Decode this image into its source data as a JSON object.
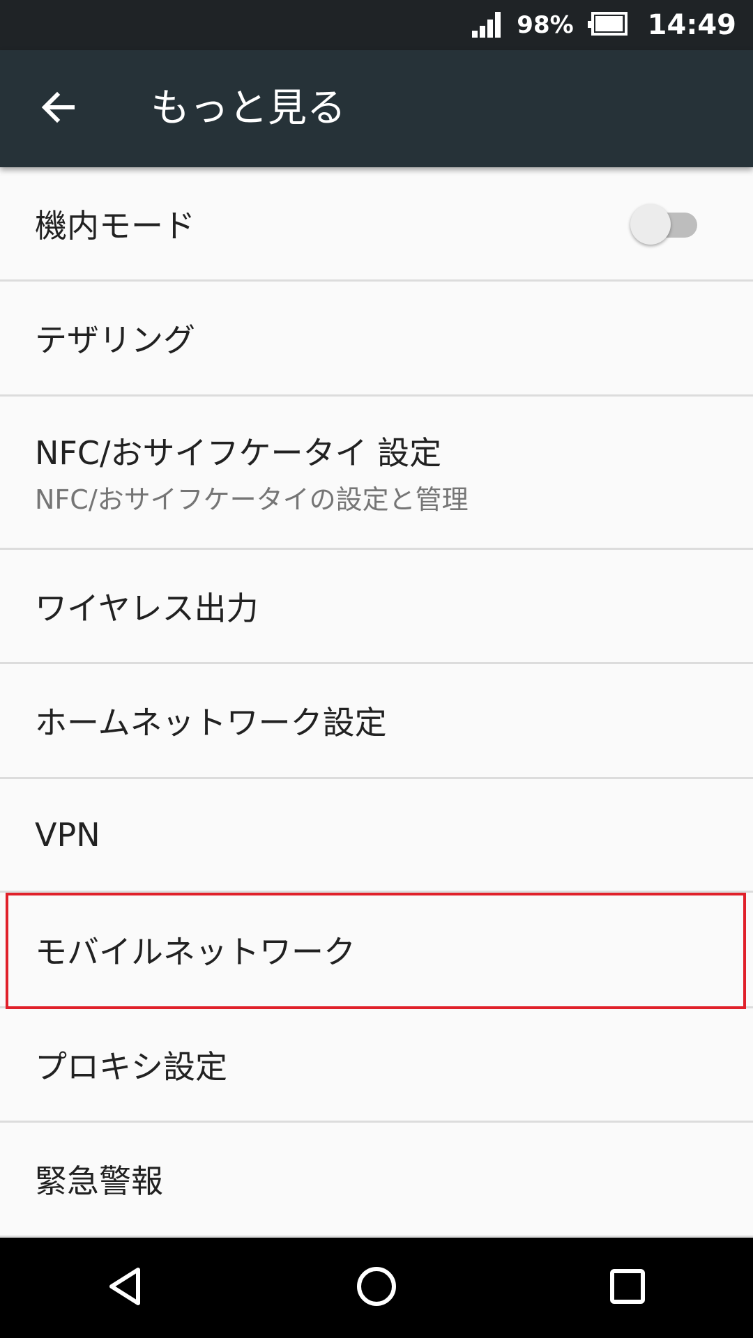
{
  "status_bar": {
    "battery_percent": "98%",
    "time": "14:49",
    "battery_level": 0.98
  },
  "app_bar": {
    "title": "もっと見る",
    "back_icon": "arrow-back-icon"
  },
  "settings": {
    "airplane_mode": {
      "label": "機内モード",
      "toggle_on": false
    },
    "tethering": {
      "label": "テザリング"
    },
    "nfc": {
      "label": "NFC/おサイフケータイ 設定",
      "summary": "NFC/おサイフケータイの設定と管理"
    },
    "wireless_output": {
      "label": "ワイヤレス出力"
    },
    "home_network": {
      "label": "ホームネットワーク設定"
    },
    "vpn": {
      "label": "VPN"
    },
    "mobile_network": {
      "label": "モバイルネットワーク",
      "highlighted": true
    },
    "proxy": {
      "label": "プロキシ設定"
    },
    "emergency_alert": {
      "label": "緊急警報"
    }
  },
  "nav_bar": {
    "back": "nav-back-icon",
    "home": "nav-home-icon",
    "recents": "nav-recents-icon"
  },
  "colors": {
    "app_bar": "#263238",
    "status_bar": "#1f2326",
    "highlight": "#e0202a",
    "background": "#fafafa"
  }
}
